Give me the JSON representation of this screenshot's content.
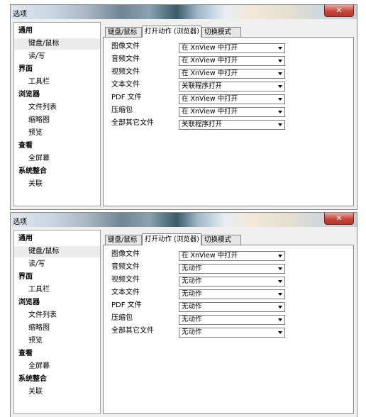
{
  "windows": [
    {
      "title": "选项",
      "tree": [
        {
          "label": "通用",
          "level": 0,
          "selected": false
        },
        {
          "label": "键盘/鼠标",
          "level": 1,
          "selected": true
        },
        {
          "label": "读/写",
          "level": 1,
          "selected": false
        },
        {
          "label": "界面",
          "level": 0,
          "selected": false
        },
        {
          "label": "工具栏",
          "level": 1,
          "selected": false
        },
        {
          "label": "浏览器",
          "level": 0,
          "selected": false
        },
        {
          "label": "文件列表",
          "level": 1,
          "selected": false
        },
        {
          "label": "缩略图",
          "level": 1,
          "selected": false
        },
        {
          "label": "预览",
          "level": 1,
          "selected": false
        },
        {
          "label": "查看",
          "level": 0,
          "selected": false
        },
        {
          "label": "全屏幕",
          "level": 1,
          "selected": false
        },
        {
          "label": "系统整合",
          "level": 0,
          "selected": false
        },
        {
          "label": "关联",
          "level": 1,
          "selected": false
        }
      ],
      "tabs": [
        {
          "label": "键盘/鼠标",
          "active": false
        },
        {
          "label": "打开动作 (浏览器)",
          "active": true
        },
        {
          "label": "切换模式",
          "active": false
        }
      ],
      "rows": [
        {
          "label": "图像文件",
          "value": "在 XnView 中打开"
        },
        {
          "label": "音频文件",
          "value": "在 XnView 中打开"
        },
        {
          "label": "视频文件",
          "value": "在 XnView 中打开"
        },
        {
          "label": "文本文件",
          "value": "关联程序打开"
        },
        {
          "label": "PDF 文件",
          "value": "在 XnView 中打开"
        },
        {
          "label": "压缩包",
          "value": "在 XnView 中打开"
        },
        {
          "label": "全部其它文件",
          "value": "关联程序打开"
        }
      ]
    },
    {
      "title": "选项",
      "tree": [
        {
          "label": "通用",
          "level": 0,
          "selected": false
        },
        {
          "label": "键盘/鼠标",
          "level": 1,
          "selected": true
        },
        {
          "label": "读/写",
          "level": 1,
          "selected": false
        },
        {
          "label": "界面",
          "level": 0,
          "selected": false
        },
        {
          "label": "工具栏",
          "level": 1,
          "selected": false
        },
        {
          "label": "浏览器",
          "level": 0,
          "selected": false
        },
        {
          "label": "文件列表",
          "level": 1,
          "selected": false
        },
        {
          "label": "缩略图",
          "level": 1,
          "selected": false
        },
        {
          "label": "预览",
          "level": 1,
          "selected": false
        },
        {
          "label": "查看",
          "level": 0,
          "selected": false
        },
        {
          "label": "全屏幕",
          "level": 1,
          "selected": false
        },
        {
          "label": "系统整合",
          "level": 0,
          "selected": false
        },
        {
          "label": "关联",
          "level": 1,
          "selected": false
        }
      ],
      "tabs": [
        {
          "label": "键盘/鼠标",
          "active": false
        },
        {
          "label": "打开动作 (浏览器)",
          "active": true
        },
        {
          "label": "切换模式",
          "active": false
        }
      ],
      "rows": [
        {
          "label": "图像文件",
          "value": "在 XnView 中打开"
        },
        {
          "label": "音频文件",
          "value": "无动作"
        },
        {
          "label": "视频文件",
          "value": "无动作"
        },
        {
          "label": "文本文件",
          "value": "无动作"
        },
        {
          "label": "PDF 文件",
          "value": "无动作"
        },
        {
          "label": "压缩包",
          "value": "无动作"
        },
        {
          "label": "全部其它文件",
          "value": "无动作"
        }
      ]
    }
  ],
  "icons": {
    "close": "close-icon",
    "dropdown": "chevron-down-icon"
  }
}
